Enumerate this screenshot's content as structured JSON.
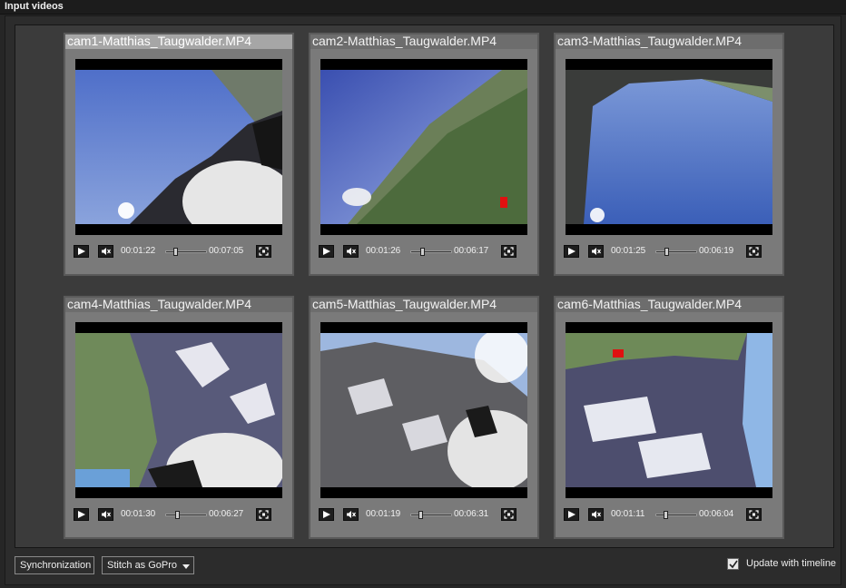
{
  "window": {
    "title": "Input videos"
  },
  "panels": [
    {
      "title": "cam1-Matthias_Taugwalder.MP4",
      "current": "00:01:22",
      "duration": "00:07:05",
      "progress": 0.2,
      "selected": true
    },
    {
      "title": "cam2-Matthias_Taugwalder.MP4",
      "current": "00:01:26",
      "duration": "00:06:17",
      "progress": 0.23,
      "selected": false
    },
    {
      "title": "cam3-Matthias_Taugwalder.MP4",
      "current": "00:01:25",
      "duration": "00:06:19",
      "progress": 0.22,
      "selected": false
    },
    {
      "title": "cam4-Matthias_Taugwalder.MP4",
      "current": "00:01:30",
      "duration": "00:06:27",
      "progress": 0.23,
      "selected": false
    },
    {
      "title": "cam5-Matthias_Taugwalder.MP4",
      "current": "00:01:19",
      "duration": "00:06:31",
      "progress": 0.2,
      "selected": false
    },
    {
      "title": "cam6-Matthias_Taugwalder.MP4",
      "current": "00:01:11",
      "duration": "00:06:04",
      "progress": 0.19,
      "selected": false
    }
  ],
  "icons": {
    "play": "play-icon",
    "mute": "mute-icon",
    "fullscreen": "fullscreen-icon"
  },
  "footer": {
    "sync_label": "Synchronization",
    "stitch_label": "Stitch  as GoPro",
    "update_label": "Update with timeline",
    "update_checked": true
  }
}
